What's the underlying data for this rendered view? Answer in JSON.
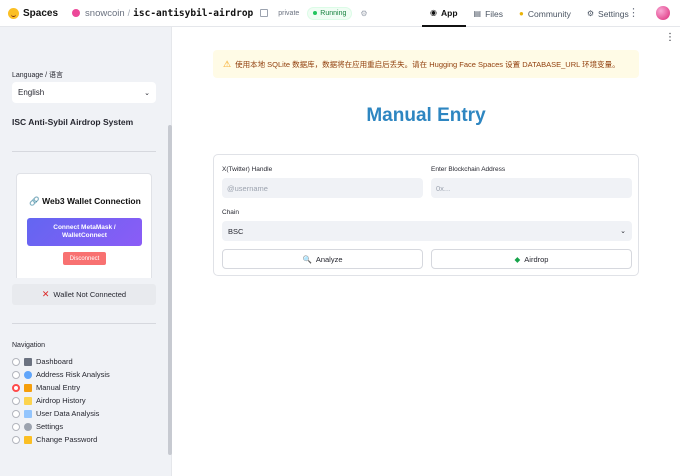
{
  "topbar": {
    "brand": "Spaces",
    "org": "snowcoin",
    "separator": "/",
    "repo": "isc-antisybil-airdrop",
    "visibility": "private",
    "status": "Running",
    "nav": [
      {
        "label": "App",
        "icon": "app-icon",
        "active": true
      },
      {
        "label": "Files",
        "icon": "files-icon",
        "active": false
      },
      {
        "label": "Community",
        "icon": "community-icon",
        "active": false
      },
      {
        "label": "Settings",
        "icon": "gear-icon",
        "active": false
      }
    ]
  },
  "sidebar": {
    "language_label": "Language / 语言",
    "language_value": "English",
    "system_title": "ISC Anti-Sybil Airdrop System",
    "wallet": {
      "title": "🔗 Web3 Wallet Connection",
      "connect_label": "Connect MetaMask / WalletConnect",
      "disconnect_label": "Disconnect",
      "status": "Wallet Not Connected"
    },
    "navigation_label": "Navigation",
    "nav_items": [
      {
        "label": "Dashboard",
        "icon": "dashboard-icon",
        "selected": false
      },
      {
        "label": "Address Risk Analysis",
        "icon": "magnifier-icon",
        "selected": false
      },
      {
        "label": "Manual Entry",
        "icon": "pencil-icon",
        "selected": true
      },
      {
        "label": "Airdrop History",
        "icon": "scroll-icon",
        "selected": false
      },
      {
        "label": "User Data Analysis",
        "icon": "chart-icon",
        "selected": false
      },
      {
        "label": "Settings",
        "icon": "gear-icon",
        "selected": false
      },
      {
        "label": "Change Password",
        "icon": "lock-icon",
        "selected": false
      }
    ]
  },
  "main": {
    "warning": "使用本地 SQLite 数据库，数据将在应用重启后丢失。请在 Hugging Face Spaces 设置 DATABASE_URL 环境变量。",
    "title": "Manual Entry",
    "form": {
      "twitter_label": "X(Twitter) Handle",
      "twitter_placeholder": "@username",
      "address_label": "Enter Blockchain Address",
      "address_placeholder": "0x...",
      "chain_label": "Chain",
      "chain_value": "BSC",
      "analyze_label": "Analyze",
      "airdrop_label": "Airdrop"
    }
  },
  "colors": {
    "accent": "#2e86c1",
    "radio_selected": "#ff4b4b",
    "sidebar_bg": "#f0f2f6",
    "connect_gradient_start": "#6366f1",
    "connect_gradient_end": "#8b5cf6",
    "disconnect": "#f87171",
    "warning_bg": "#fffbe6"
  }
}
